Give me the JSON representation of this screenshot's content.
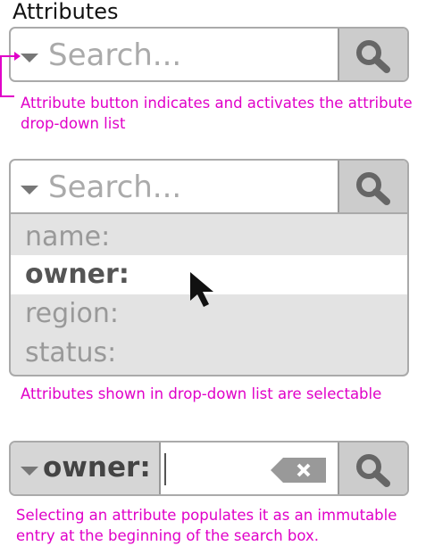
{
  "header": {
    "title": "Attributes"
  },
  "search": {
    "placeholder": "Search..."
  },
  "notes": {
    "attribute_button": [
      "Attribute button indicates and activates the attribute",
      "drop-down list"
    ],
    "selectable": "Attributes shown in drop-down list are selectable",
    "immutable": [
      "Selecting an attribute populates it as an immutable",
      "entry at the beginning of the search box."
    ]
  },
  "dropdown": {
    "options": [
      "name:",
      "owner:",
      "region:",
      "status:"
    ],
    "highlighted": "owner:"
  },
  "selected_attribute": {
    "label": "owner:"
  },
  "icons": {
    "attribute_caret": "caret-down-icon",
    "search": "magnifier-icon",
    "clear": "backspace-x-icon",
    "pointer": "mouse-pointer-icon"
  },
  "colors": {
    "annotation": "#e000c8",
    "search_button": "#cccccc",
    "dropdown_bg": "#e3e3e3",
    "highlight_bg": "#ffffff"
  }
}
